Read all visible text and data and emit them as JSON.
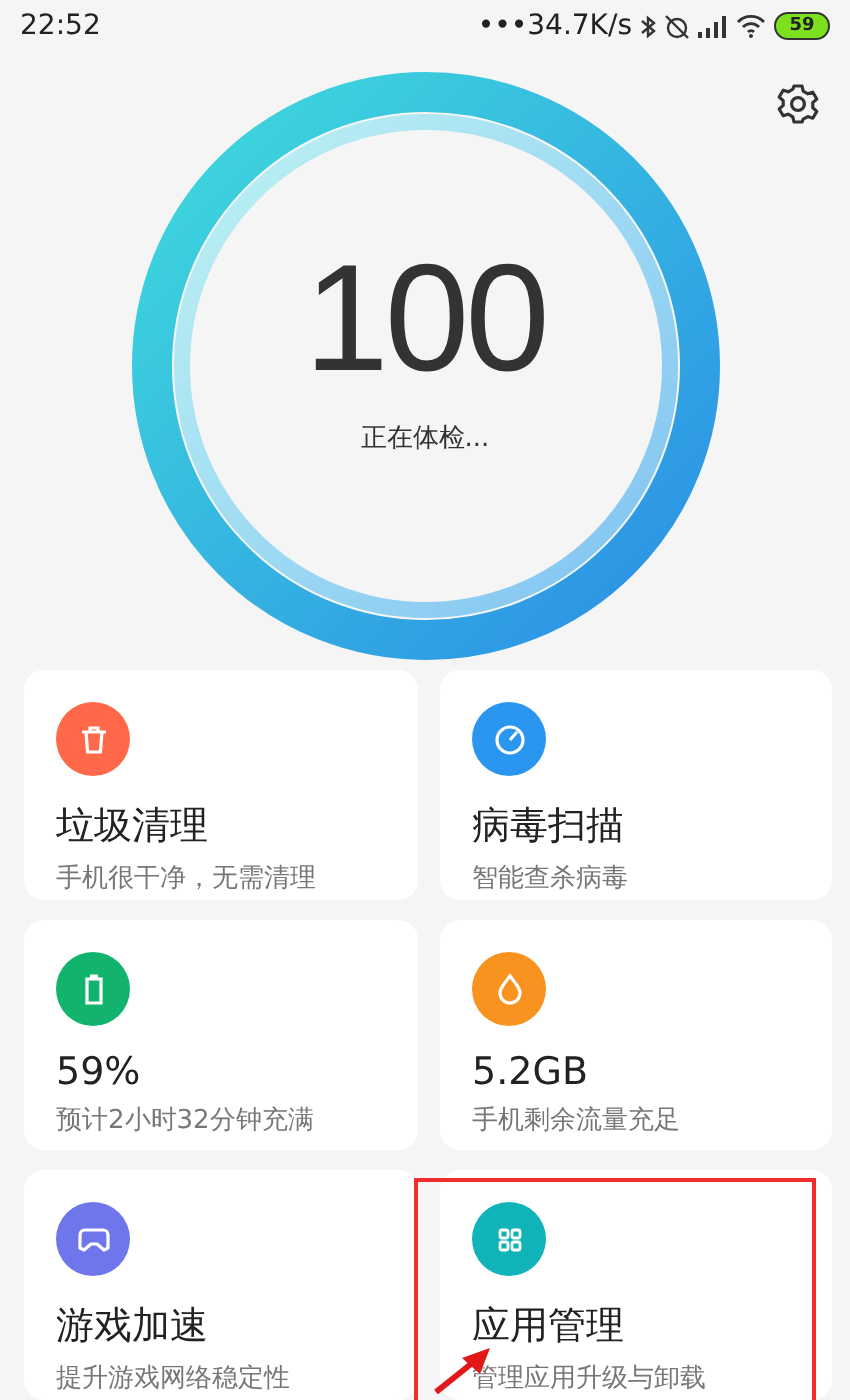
{
  "status_bar": {
    "time": "22:52",
    "network_speed": "•••34.7K/s",
    "battery": "59"
  },
  "score": {
    "value": "100",
    "status": "正在体检..."
  },
  "cards": [
    {
      "kind": "trash",
      "color": "#ff6848",
      "title": "垃圾清理",
      "subtitle": "手机很干净，无需清理",
      "highlighted": false
    },
    {
      "kind": "gauge",
      "color": "#2a96f0",
      "title": "病毒扫描",
      "subtitle": "智能查杀病毒",
      "highlighted": false
    },
    {
      "kind": "battery",
      "color": "#12b36c",
      "title": "59%",
      "subtitle": "预计2小时32分钟充满",
      "highlighted": false
    },
    {
      "kind": "drop",
      "color": "#f7931e",
      "title": "5.2GB",
      "subtitle": "手机剩余流量充足",
      "highlighted": false
    },
    {
      "kind": "gamepad",
      "color": "#6f76ec",
      "title": "游戏加速",
      "subtitle": "提升游戏网络稳定性",
      "highlighted": false
    },
    {
      "kind": "grid",
      "color": "#10b4b8",
      "title": "应用管理",
      "subtitle": "管理应用升级与卸载",
      "highlighted": true
    }
  ]
}
